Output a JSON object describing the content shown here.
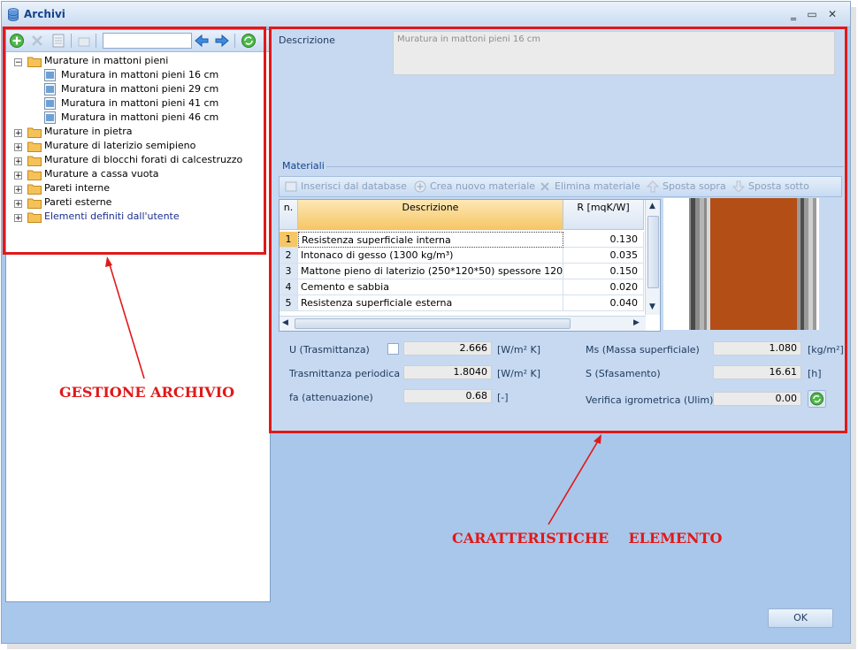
{
  "window": {
    "title": "Archivi",
    "buttons": {
      "minimize": "‗",
      "maximize": "▭",
      "close": "✕"
    }
  },
  "tree": {
    "search_value": "",
    "nodes": [
      {
        "label": "Murature in mattoni pieni",
        "expanded": true,
        "children": [
          "Muratura in mattoni pieni 16 cm",
          "Muratura in mattoni pieni 29 cm",
          "Muratura in mattoni pieni 41 cm",
          "Muratura in mattoni pieni 46 cm"
        ]
      },
      {
        "label": "Murature in pietra"
      },
      {
        "label": "Murature di laterizio semipieno"
      },
      {
        "label": "Murature di blocchi forati di calcestruzzo"
      },
      {
        "label": "Murature a cassa vuota"
      },
      {
        "label": "Pareti interne"
      },
      {
        "label": "Pareti esterne"
      },
      {
        "label": "Elementi definiti dall'utente"
      }
    ]
  },
  "details": {
    "description_label": "Descrizione",
    "description_value": "Muratura in mattoni pieni 16 cm",
    "materials_title": "Materiali",
    "toolbar": [
      "Inserisci dal database",
      "Crea nuovo materiale",
      "Elimina materiale",
      "Sposta sopra",
      "Sposta sotto"
    ],
    "grid": {
      "headers": [
        "n.",
        "Descrizione",
        "R [mqK/W]"
      ],
      "rows": [
        {
          "n": "1",
          "desc": "Resistenza superficiale interna",
          "r": "0.130"
        },
        {
          "n": "2",
          "desc": "Intonaco di gesso (1300 kg/m³)",
          "r": "0.035"
        },
        {
          "n": "3",
          "desc": "Mattone pieno di laterizio (250*120*50) spessore 120",
          "r": "0.150"
        },
        {
          "n": "4",
          "desc": "Cemento e sabbia",
          "r": "0.020"
        },
        {
          "n": "5",
          "desc": "Resistenza superficiale esterna",
          "r": "0.040"
        }
      ]
    },
    "props": {
      "u_label": "U (Trasmittanza)",
      "u_value": "2.666",
      "u_unit": "[W/m² K]",
      "tp_label": "Trasmittanza periodica",
      "tp_value": "1.8040",
      "tp_unit": "[W/m² K]",
      "fa_label": "fa (attenuazione)",
      "fa_value": "0.68",
      "fa_unit": "[-]",
      "ms_label": "Ms (Massa superficiale)",
      "ms_value": "1.080",
      "ms_unit": "[kg/m²]",
      "s_label": "S (Sfasamento)",
      "s_value": "16.61",
      "s_unit": "[h]",
      "vi_label": "Verifica igrometrica (Ulim)",
      "vi_value": "0.00"
    }
  },
  "ok_label": "OK",
  "annotations": {
    "left": "GESTIONE ARCHIVIO",
    "right": "CARATTERISTICHE    ELEMENTO"
  },
  "colors": {
    "annotation": "#e01919",
    "window_bg": "#a9c7ea",
    "accent": "#15428b"
  }
}
